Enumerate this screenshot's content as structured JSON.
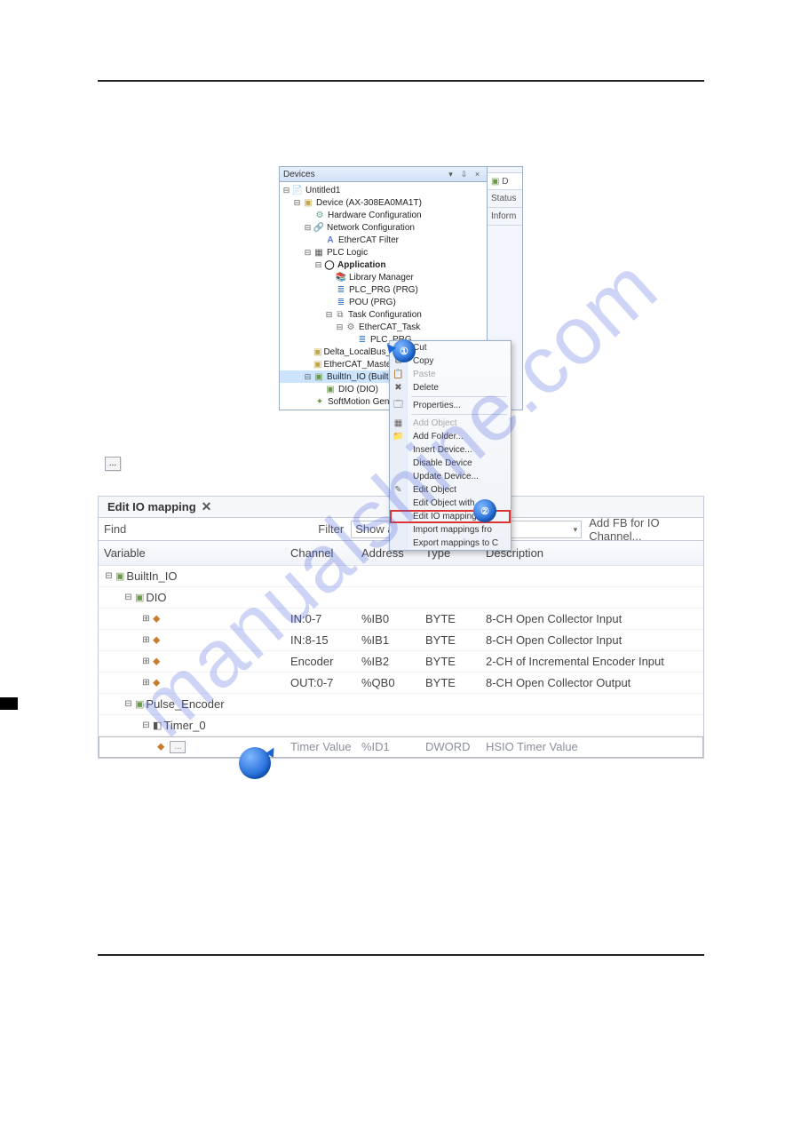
{
  "watermark": "manualshine.com",
  "devices_pane": {
    "title": "Devices",
    "ctrl_dropdown": "▾",
    "ctrl_pin": "⇩",
    "ctrl_close": "×",
    "tree": {
      "project": "Untitled1",
      "device": "Device (AX-308EA0MA1T)",
      "hardware_conf": "Hardware Configuration",
      "network_conf": "Network Configuration",
      "ethercat_filter": "EtherCAT Filter",
      "plc_logic": "PLC Logic",
      "application": "Application",
      "library_manager": "Library Manager",
      "plc_prg": "PLC_PRG (PRG)",
      "pou": "POU (PRG)",
      "task_conf": "Task Configuration",
      "ethercat_task": "EtherCAT_Task",
      "task_plc_prg": "PLC_PRG",
      "delta_localbus": "Delta_LocalBus_Master (Delta LocalBus Master)",
      "ecat_master_sm": "EtherCAT_Master_SoftMotion (EtherCAT Master SoftMotion)",
      "builtin_io": "BuiltIn_IO (BuiltIn_IO)",
      "dio": "DIO (DIO)",
      "sm_pool": "SoftMotion General Axis Pool"
    }
  },
  "side_tabs": {
    "tab0": "D",
    "tab1": "Status",
    "tab2": "Inform"
  },
  "ctx": {
    "cut": "Cut",
    "copy": "Copy",
    "paste": "Paste",
    "delete": "Delete",
    "properties": "Properties...",
    "add_object": "Add Object",
    "add_folder": "Add Folder...",
    "insert_device": "Insert Device...",
    "disable_device": "Disable Device",
    "update_device": "Update Device...",
    "edit_object": "Edit Object",
    "edit_object_with": "Edit Object with...",
    "edit_io_mapping": "Edit IO mapping",
    "import_mappings": "Import mappings fro",
    "export_mappings": "Export mappings to C"
  },
  "mouse_badges": {
    "b1": "①",
    "b2": "②"
  },
  "mid": {
    "dots": "..."
  },
  "iomap": {
    "tab_title": "Edit IO mapping",
    "tab_close": "✕",
    "find_label": "Find",
    "filter_label": "Filter",
    "filter_value": "Show all",
    "filter_caret": "▾",
    "add_fb": "Add FB for IO Channel...",
    "headers": {
      "variable": "Variable",
      "channel": "Channel",
      "address": "Address",
      "type": "Type",
      "description": "Description"
    },
    "rows": {
      "builtin": "BuiltIn_IO",
      "dio": "DIO",
      "r0": {
        "channel": "IN:0-7",
        "address": "%IB0",
        "type": "BYTE",
        "desc": "8-CH Open Collector Input"
      },
      "r1": {
        "channel": "IN:8-15",
        "address": "%IB1",
        "type": "BYTE",
        "desc": "8-CH Open Collector Input"
      },
      "r2": {
        "channel": "Encoder",
        "address": "%IB2",
        "type": "BYTE",
        "desc": "2-CH of Incremental Encoder Input"
      },
      "r3": {
        "channel": "OUT:0-7",
        "address": "%QB0",
        "type": "BYTE",
        "desc": "8-CH Open Collector Output"
      },
      "pulse_enc": "Pulse_Encoder",
      "timer0": "Timer_0",
      "r4": {
        "channel": "Timer Value",
        "address": "%ID1",
        "type": "DWORD",
        "desc": "HSIO Timer Value"
      }
    },
    "dots_inline": "..."
  }
}
